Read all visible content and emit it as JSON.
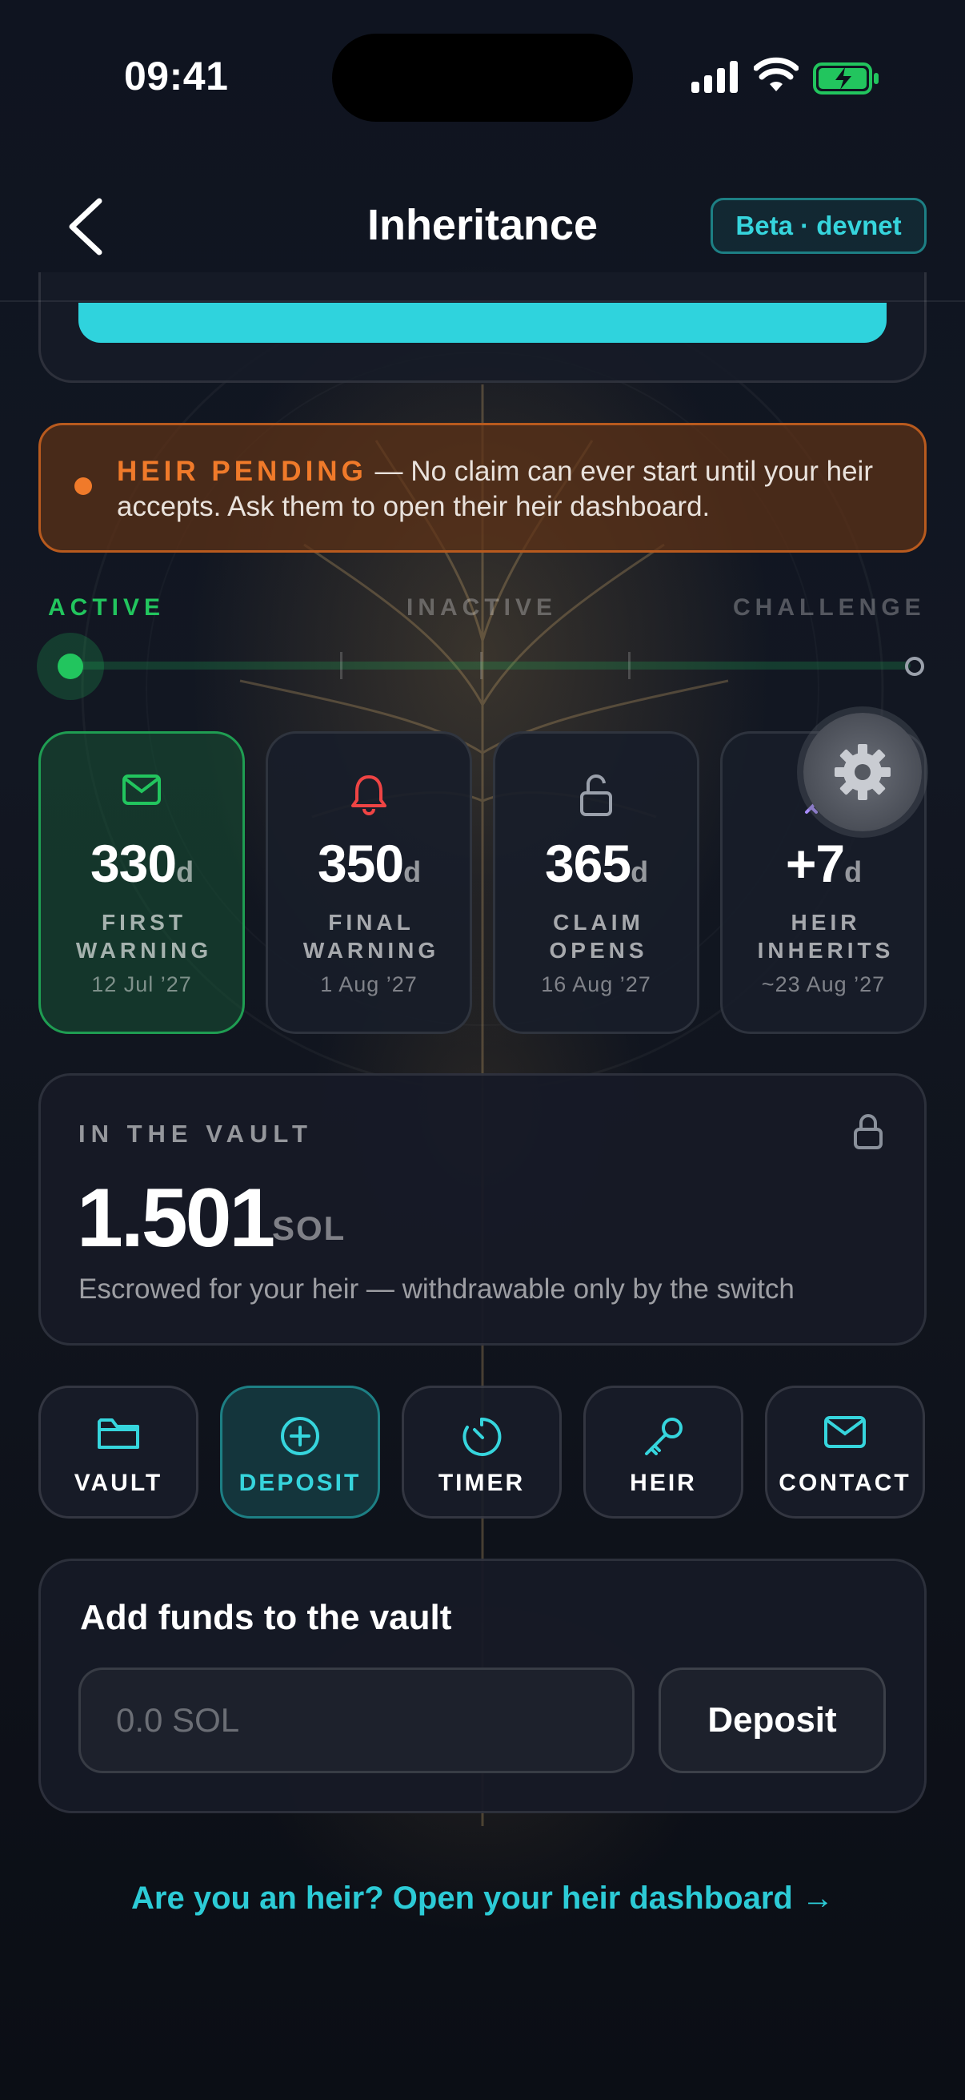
{
  "status_bar": {
    "time": "09:41"
  },
  "header": {
    "title": "Inheritance",
    "badge": "Beta · devnet"
  },
  "banner": {
    "tag": "HEIR PENDING",
    "separator": " — ",
    "message": "No claim can ever start until your heir accepts. Ask them to open their heir dashboard.",
    "color": "#f07a2a"
  },
  "timeline": {
    "stages": [
      "ACTIVE",
      "INACTIVE",
      "CHALLENGE"
    ],
    "current_stage": "ACTIVE",
    "progress": 0.0
  },
  "milestones": [
    {
      "icon": "mail-icon",
      "value": "330",
      "unit": "d",
      "label": "FIRST WARNING",
      "date": "12 Jul ’27",
      "active": true
    },
    {
      "icon": "bell-icon",
      "value": "350",
      "unit": "d",
      "label": "FINAL WARNING",
      "date": "1 Aug ’27",
      "active": false
    },
    {
      "icon": "unlock-icon",
      "value": "365",
      "unit": "d",
      "label": "CLAIM OPENS",
      "date": "16 Aug ’27",
      "active": false
    },
    {
      "icon": "key-icon",
      "value": "+7",
      "unit": "d",
      "label": "HEIR INHERITS",
      "date": "~23 Aug ’27",
      "active": false
    }
  ],
  "vault": {
    "label": "IN THE VAULT",
    "amount": "1.501",
    "unit": "SOL",
    "subtitle": "Escrowed for your heir — withdrawable only by the switch"
  },
  "tabs": [
    {
      "label": "VAULT",
      "icon": "folder-icon",
      "selected": false
    },
    {
      "label": "DEPOSIT",
      "icon": "plus-circle-icon",
      "selected": true
    },
    {
      "label": "TIMER",
      "icon": "timer-icon",
      "selected": false
    },
    {
      "label": "HEIR",
      "icon": "key-icon",
      "selected": false
    },
    {
      "label": "CONTACT",
      "icon": "mail-icon",
      "selected": false
    }
  ],
  "deposit": {
    "title": "Add funds to the vault",
    "input_placeholder": "0.0 SOL",
    "input_value": "",
    "button_label": "Deposit"
  },
  "footer": {
    "heir_link": "Are you an heir? Open your heir dashboard →"
  },
  "colors": {
    "accent_cyan": "#36d5dd",
    "active_green": "#22c55e",
    "warning_orange": "#f07a2a",
    "background": "#0d111b"
  }
}
